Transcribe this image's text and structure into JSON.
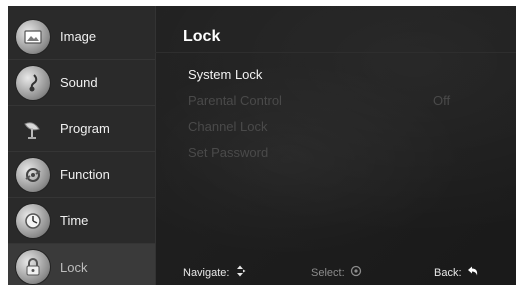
{
  "sidebar": {
    "items": [
      {
        "label": "Image",
        "icon": "image-icon",
        "active": false
      },
      {
        "label": "Sound",
        "icon": "music-note-icon",
        "active": false
      },
      {
        "label": "Program",
        "icon": "satellite-dish-icon",
        "active": false
      },
      {
        "label": "Function",
        "icon": "function-icon",
        "active": false
      },
      {
        "label": "Time",
        "icon": "clock-icon",
        "active": false
      },
      {
        "label": "Lock",
        "icon": "padlock-icon",
        "active": true
      }
    ]
  },
  "main": {
    "title": "Lock",
    "rows": [
      {
        "label": "System Lock",
        "value": "",
        "state": "active"
      },
      {
        "label": "Parental Control",
        "value": "Off",
        "state": "disabled"
      },
      {
        "label": "Channel Lock",
        "value": "",
        "state": "disabled"
      },
      {
        "label": "Set Password",
        "value": "",
        "state": "disabled"
      }
    ]
  },
  "footer": {
    "navigate_label": "Navigate:",
    "select_label": "Select:",
    "back_label": "Back:"
  },
  "colors": {
    "background": "#1e1e1e",
    "sidebar": "#2a2a2a",
    "active_text": "#f2f2f2",
    "disabled_text": "#4a4a4a"
  }
}
